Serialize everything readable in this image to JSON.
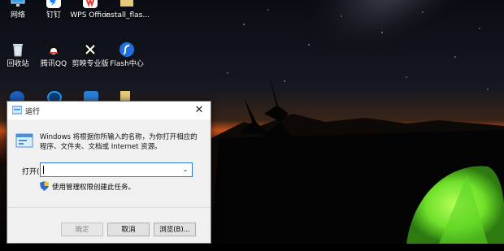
{
  "desktop": {
    "icons": [
      {
        "label": "网络"
      },
      {
        "label": "钉钉"
      },
      {
        "label": "WPS Office"
      },
      {
        "label": "install_flas..."
      },
      {
        "label": "回收站"
      },
      {
        "label": "腾讯QQ"
      },
      {
        "label": "剪映专业版"
      },
      {
        "label": "Flash中心"
      }
    ]
  },
  "run_dialog": {
    "title": "运行",
    "close_glyph": "✕",
    "description": "Windows 将根据你所输入的名称，为你打开相应的程序、文件夹、文档或 Internet 资源。",
    "open_label": "打开(O):",
    "open_value": "",
    "dropdown_glyph": "⌄",
    "admin_note": "使用管理权限创建此任务。",
    "buttons": {
      "ok": "确定",
      "cancel": "取消",
      "browse": "浏览(B)..."
    }
  },
  "colors": {
    "accent": "#2b7bd6",
    "tent": "#7bf03a",
    "horizon_glow": "#e0561a"
  }
}
